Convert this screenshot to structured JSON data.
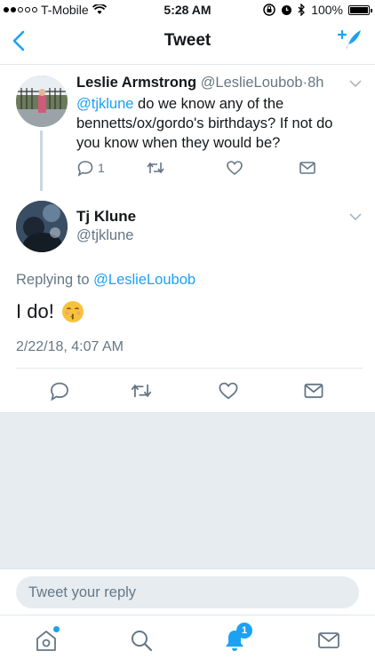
{
  "status_bar": {
    "carrier": "T-Mobile",
    "time": "5:28 AM",
    "battery": "100%"
  },
  "nav": {
    "title": "Tweet"
  },
  "parent_tweet": {
    "name": "Leslie Armstrong",
    "handle": "@LeslieLoubob",
    "separator": "·",
    "time": "8h",
    "mention": "@tjklune",
    "text": " do we know any of the bennetts/ox/gordo's birthdays? If not do you know when they would be?",
    "reply_count": "1"
  },
  "main_tweet": {
    "name": "Tj Klune",
    "handle": "@tjklune",
    "replying_prefix": "Replying to ",
    "replying_to": "@LeslieLoubob",
    "text": "I do!",
    "emoji": "kissing-face",
    "timestamp": "2/22/18, 4:07 AM"
  },
  "reply": {
    "placeholder": "Tweet your reply"
  },
  "tabbar": {
    "notifications_badge": "1"
  },
  "colors": {
    "accent": "#1da1f2",
    "secondary_text": "#657786",
    "divider": "#e1e8ed",
    "background_gray": "#e6ecf0"
  }
}
